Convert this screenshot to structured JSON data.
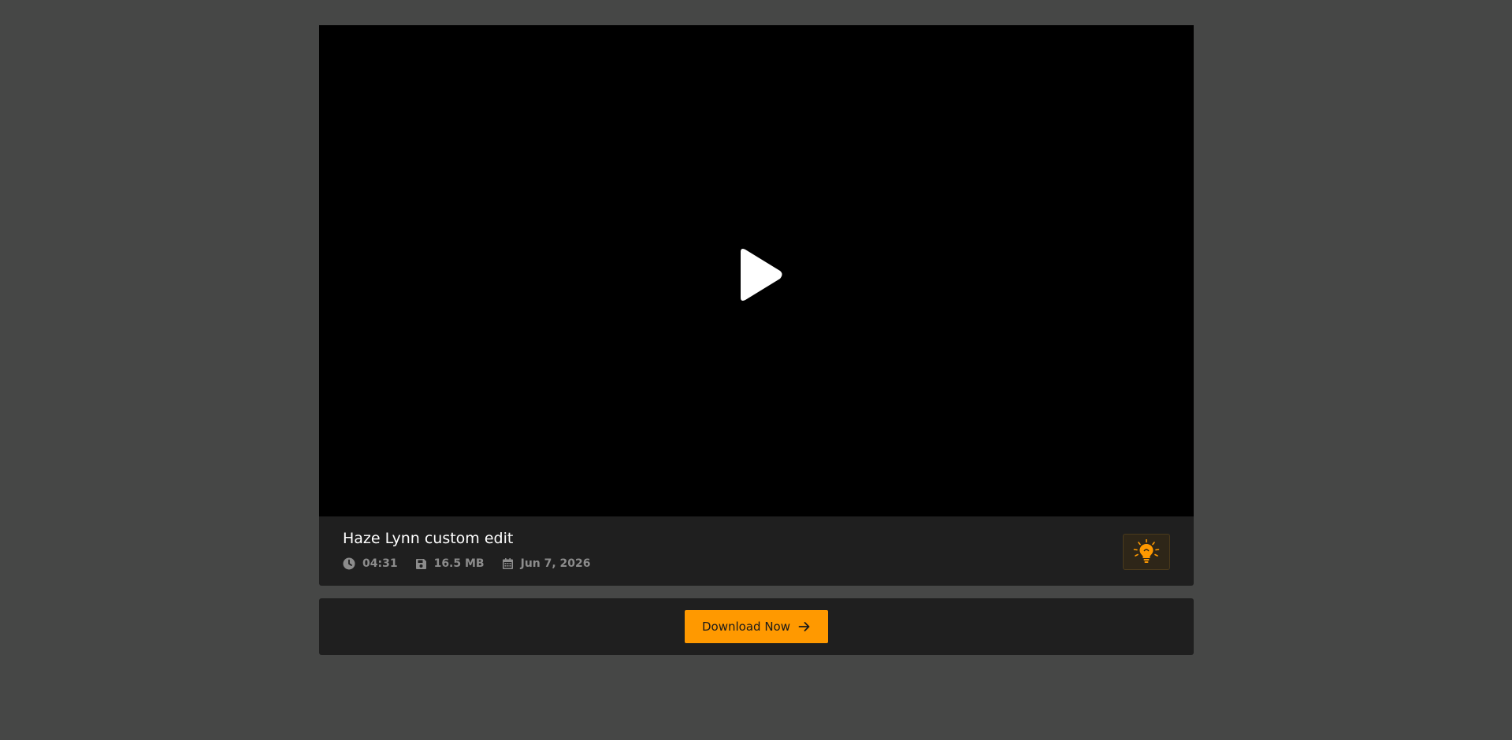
{
  "video": {
    "title": "Haze Lynn custom edit",
    "duration": "04:31",
    "size": "16.5 MB",
    "date": "Jun 7, 2026"
  },
  "actions": {
    "download_label": "Download Now"
  },
  "colors": {
    "background": "#464746",
    "accent": "#ff9900",
    "panel": "#1f1f1f",
    "meta_text": "#8c8c8c"
  },
  "icons": {
    "play": "play-icon",
    "clock": "clock-icon",
    "disk": "floppy-disk-icon",
    "calendar": "calendar-icon",
    "lightbulb": "lightbulb-icon",
    "arrow": "arrow-right-icon"
  }
}
